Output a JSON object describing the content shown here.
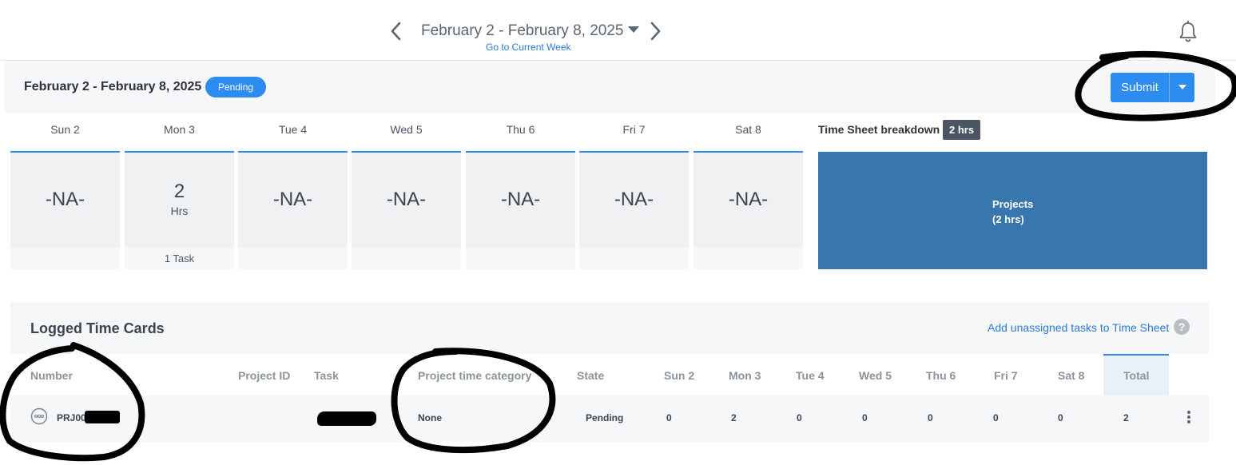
{
  "top_nav": {
    "week_range": "February 2 - February 8, 2025",
    "go_current_week": "Go to Current Week",
    "prev_icon": "chevron-left-icon",
    "next_icon": "chevron-right-icon",
    "notifications_icon": "bell-icon"
  },
  "timesheet": {
    "range": "February 2 - February 8, 2025",
    "status": "Pending",
    "submit_label": "Submit"
  },
  "days": [
    {
      "label": "Sun 2",
      "value": "-NA-",
      "footer": ""
    },
    {
      "label": "Mon 3",
      "hours": "2",
      "unit": "Hrs",
      "footer": "1 Task"
    },
    {
      "label": "Tue 4",
      "value": "-NA-",
      "footer": ""
    },
    {
      "label": "Wed 5",
      "value": "-NA-",
      "footer": ""
    },
    {
      "label": "Thu 6",
      "value": "-NA-",
      "footer": ""
    },
    {
      "label": "Fri 7",
      "value": "-NA-",
      "footer": ""
    },
    {
      "label": "Sat 8",
      "value": "-NA-",
      "footer": ""
    }
  ],
  "breakdown": {
    "title": "Time Sheet breakdown",
    "total": "2 hrs",
    "segment_name": "Projects",
    "segment_hours": "(2 hrs)",
    "segment_color": "#3777ae"
  },
  "logged_cards": {
    "title": "Logged Time Cards",
    "add_link": "Add unassigned tasks to Time Sheet",
    "help_icon": "?",
    "columns": [
      "Number",
      "Project ID",
      "Task",
      "Project time category",
      "State",
      "Sun 2",
      "Mon 3",
      "Tue 4",
      "Wed 5",
      "Thu 6",
      "Fri 7",
      "Sat 8",
      "Total"
    ],
    "rows": [
      {
        "number": "PRJ00",
        "project_id": "",
        "task": "",
        "category": "None",
        "state": "Pending",
        "sun": "0",
        "mon": "2",
        "tue": "0",
        "wed": "0",
        "thu": "0",
        "fri": "0",
        "sat": "0",
        "total": "2"
      }
    ]
  },
  "colors": {
    "accent": "#2d8cf0",
    "link": "#2c7bd6",
    "breakdown_badge": "#4b5563"
  }
}
